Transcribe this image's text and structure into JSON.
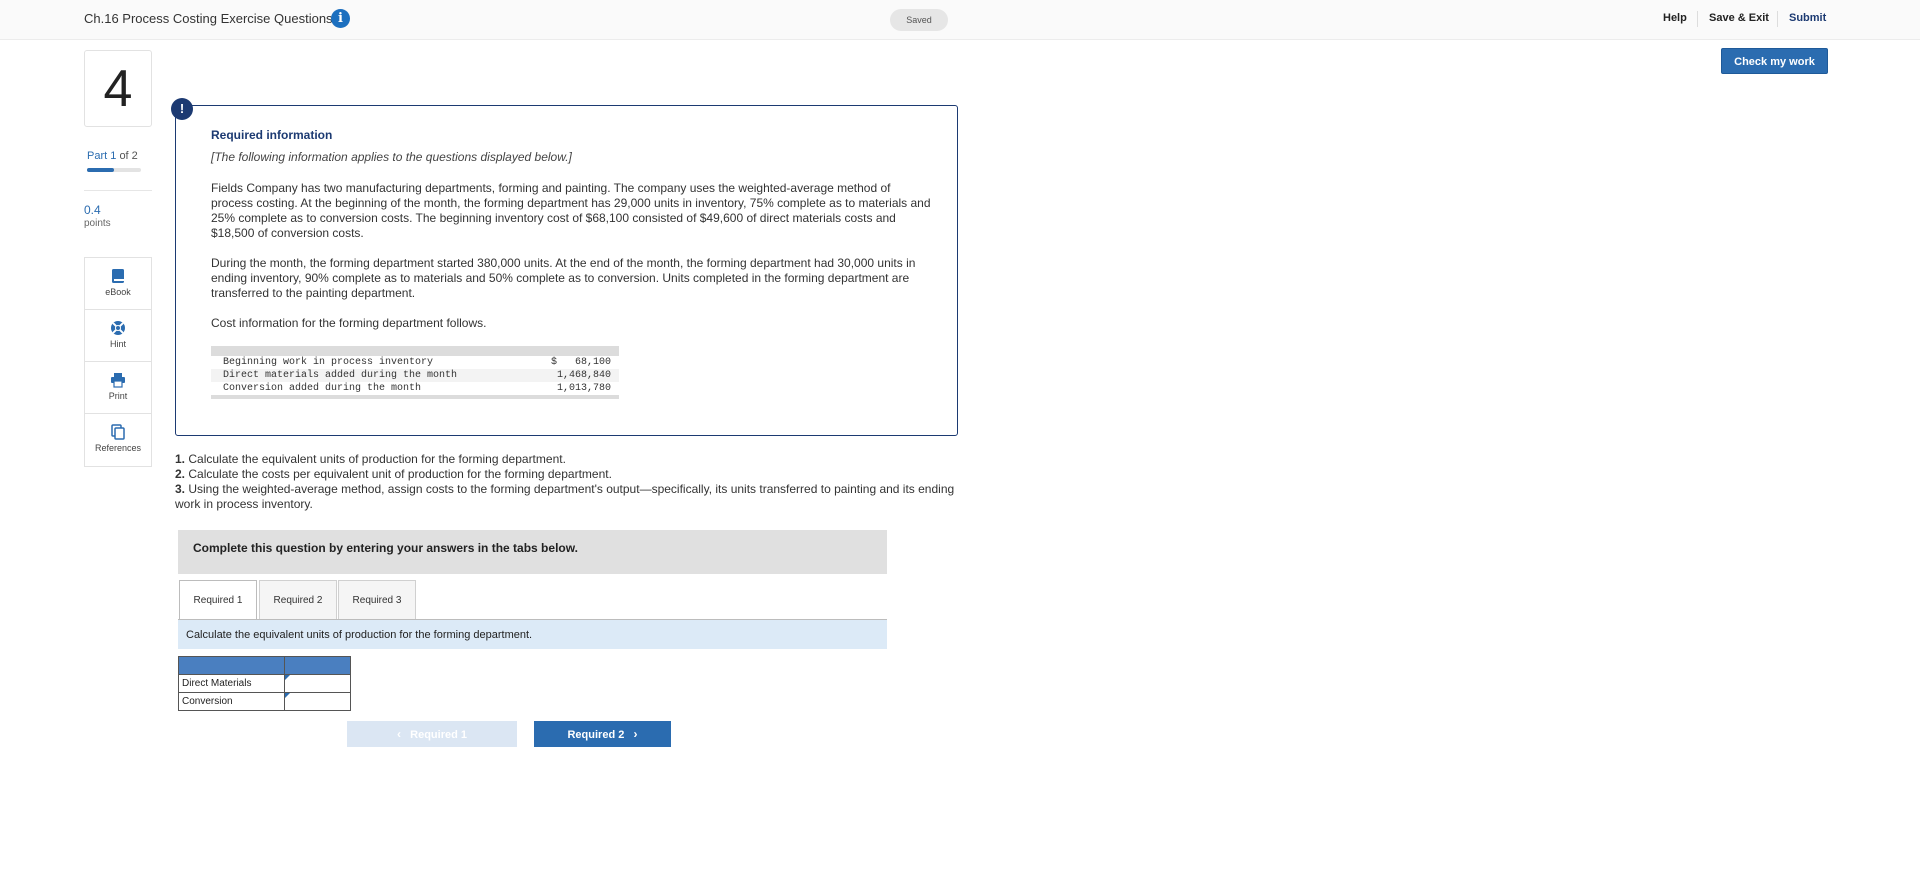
{
  "header": {
    "title": "Ch.16 Process Costing Exercise Questions",
    "status": "Saved",
    "help": "Help",
    "save_exit": "Save & Exit",
    "submit": "Submit",
    "check": "Check my work"
  },
  "sidebar": {
    "question_number": "4",
    "part_label": "Part",
    "part_current": "1",
    "part_of": "of 2",
    "part_progress_fraction": 0.5,
    "points_value": "0.4",
    "points_label": "points",
    "tools": [
      {
        "label": "eBook",
        "icon": "book-icon"
      },
      {
        "label": "Hint",
        "icon": "lifebuoy-icon"
      },
      {
        "label": "Print",
        "icon": "printer-icon"
      },
      {
        "label": "References",
        "icon": "copy-icon"
      }
    ]
  },
  "required_info": {
    "title": "Required information",
    "subtitle": "[The following information applies to the questions displayed below.]",
    "para1": "Fields Company has two manufacturing departments, forming and painting. The company uses the weighted-average method of process costing. At the beginning of the month, the forming department has 29,000 units in inventory, 75% complete as to materials and 25% complete as to conversion costs. The beginning inventory cost of $68,100 consisted of $49,600 of direct materials costs and $18,500 of conversion costs.",
    "para2": "During the month, the forming department started 380,000 units. At the end of the month, the forming department had 30,000 units in ending inventory, 90% complete as to materials and 50% complete as to conversion. Units completed in the forming department are transferred to the painting department.",
    "para3": "Cost information for the forming department follows.",
    "cost_rows": [
      {
        "label": "Beginning work in process inventory",
        "value": "$   68,100"
      },
      {
        "label": "Direct materials added during the month",
        "value": "1,468,840"
      },
      {
        "label": "Conversion added during the month",
        "value": "1,013,780"
      }
    ]
  },
  "questions": [
    {
      "num": "1.",
      "text": " Calculate the equivalent units of production for the forming department."
    },
    {
      "num": "2.",
      "text": " Calculate the costs per equivalent unit of production for the forming department."
    },
    {
      "num": "3.",
      "text": " Using the weighted-average method, assign costs to the forming department's output—specifically, its units transferred to painting and its ending work in process inventory."
    }
  ],
  "answer_section": {
    "banner": "Complete this question by entering your answers in the tabs below.",
    "tabs": [
      "Required 1",
      "Required 2",
      "Required 3"
    ],
    "active_tab": 0,
    "instruction": "Calculate the equivalent units of production for the forming department.",
    "rows": [
      {
        "label": "Direct Materials",
        "value": ""
      },
      {
        "label": "Conversion",
        "value": ""
      }
    ],
    "prev_label": "Required 1",
    "next_label": "Required 2"
  },
  "colors": {
    "primary": "#2b6cb0",
    "navy": "#1c3a72",
    "instruction_bg": "#dceaf7"
  }
}
